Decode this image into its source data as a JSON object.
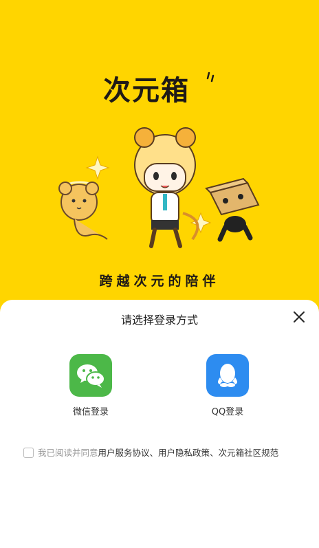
{
  "brand": {
    "logo_text": "次元箱",
    "tagline": "跨越次元的陪伴"
  },
  "login_sheet": {
    "title": "请选择登录方式",
    "options": [
      {
        "label": "微信登录",
        "icon": "wechat-icon",
        "color": "#4CB848"
      },
      {
        "label": "QQ登录",
        "icon": "qq-icon",
        "color": "#2D8CF0"
      }
    ],
    "agreement": {
      "prefix": "我已阅读并同意",
      "user_service": "用户服务协议",
      "sep1": "、",
      "privacy": "用户隐私政策",
      "sep2": "、",
      "community": "次元箱社区规范",
      "checked": false
    }
  },
  "colors": {
    "brand_yellow": "#FFD500",
    "text_dark": "#1f1a17"
  }
}
